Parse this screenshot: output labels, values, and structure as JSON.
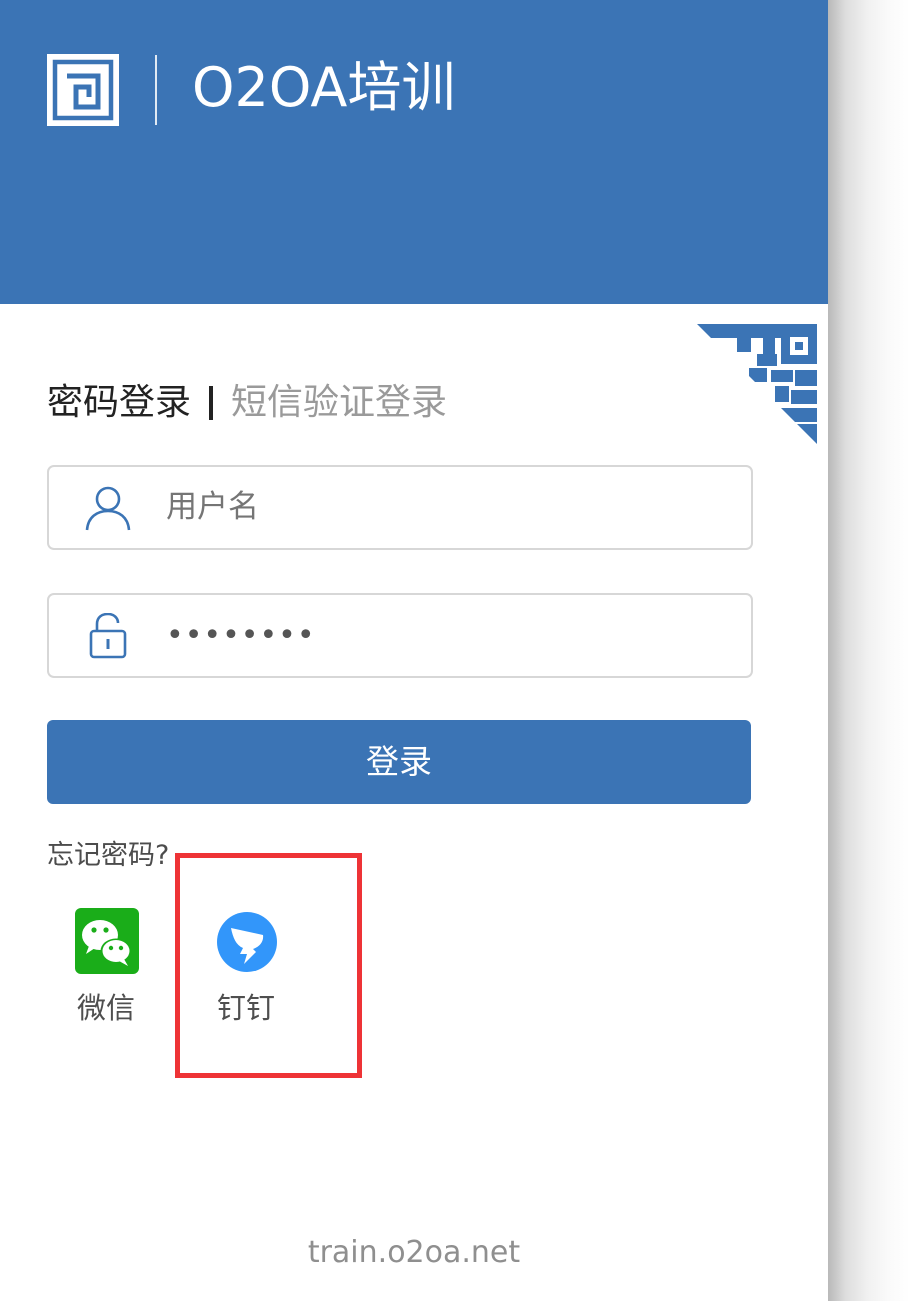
{
  "header": {
    "title": "O2OA培训",
    "logo_icon": "o2oa-logo-icon",
    "background_color": "#3b74b5"
  },
  "login_tabs": [
    {
      "label": "密码登录",
      "active": true
    },
    {
      "label": "短信验证登录",
      "active": false
    }
  ],
  "fields": {
    "username": {
      "placeholder": "用户名",
      "value": "",
      "icon": "user-icon"
    },
    "password": {
      "value": "••••••••",
      "icon": "lock-icon"
    }
  },
  "login_button": {
    "label": "登录",
    "color": "#3b74b5"
  },
  "forgot_password": {
    "label": "忘记密码?"
  },
  "social_logins": [
    {
      "label": "微信",
      "icon": "wechat-icon",
      "color": "#1aad19"
    },
    {
      "label": "钉钉",
      "icon": "dingtalk-icon",
      "color": "#3296fa"
    }
  ],
  "qr_code": {
    "icon": "qr-code-corner-icon"
  },
  "highlight": {
    "target": "dingtalk",
    "color": "#ee3336"
  },
  "footer": {
    "domain": "train.o2oa.net"
  }
}
